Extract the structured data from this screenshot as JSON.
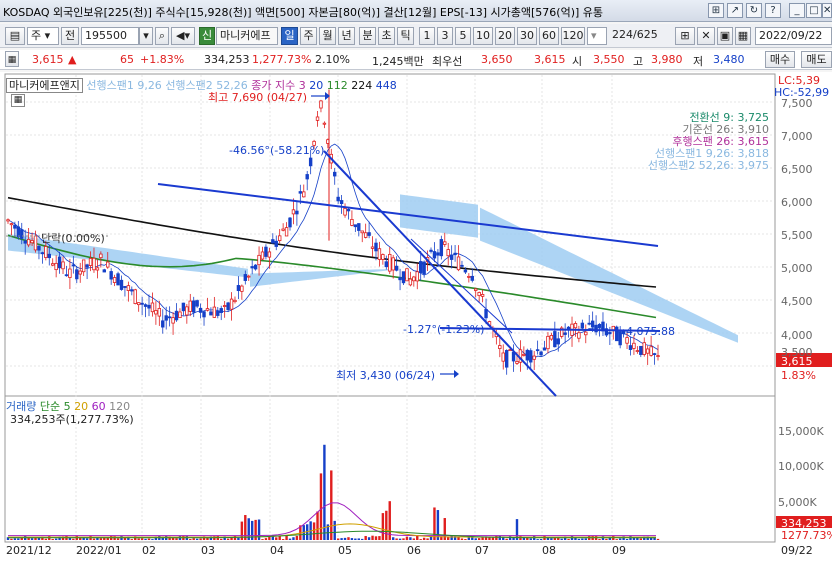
{
  "window": {
    "title": "KOSDAQ 외국인보유[225(천)] 주식수[15,928(천)] 액면[500] 자본금[80(억)] 결산[12월] EPS[-13] 시가총액[576(억)] 유통",
    "buttons": [
      "⊞",
      "↗",
      "↻",
      "?",
      "_",
      "□",
      "✕"
    ]
  },
  "toolbar": {
    "market": "주",
    "code_icon": "전",
    "code": "195500",
    "name_badge": "신",
    "name": "마니커에프",
    "period_tabs": [
      "일",
      "주",
      "월",
      "년",
      "분",
      "초",
      "틱"
    ],
    "period_active": "일",
    "intervals": [
      "1",
      "3",
      "5",
      "10",
      "20",
      "30",
      "60",
      "120"
    ],
    "page": "224",
    "total": "/625",
    "date": "2022/09/22",
    "buy": "매수",
    "sell": "매도"
  },
  "price_row": {
    "price": "3,615",
    "arrow": "▲",
    "change": "65",
    "pct": "+1.83%",
    "volume": "334,253",
    "vol_pct": "1,277.73%",
    "turnover": "2.10%",
    "amount": "1,245백만",
    "label_min": "최우선",
    "ask": "3,650",
    "bid": "3,615",
    "open_label": "시",
    "open": "3,550",
    "high_label": "고",
    "high": "3,980",
    "low_label": "저",
    "low": "3,480"
  },
  "legend": {
    "name": "마니커에프앤지",
    "span1": "선행스팬1 9,26",
    "span2": "선행스팬2 52,26",
    "ma_label": "종가 지수 3",
    "ma20": "20",
    "ma112": "112",
    "ma224": "224",
    "ma448": "448",
    "lc": "LC:5,39",
    "hc": "HC:-52,99"
  },
  "ichimoku_values": [
    {
      "label": "전환선 9: 3,725",
      "color": "#1a8a6a"
    },
    {
      "label": "기준선 26: 3,910",
      "color": "#777777"
    },
    {
      "label": "후행스팬 26: 3,615",
      "color": "#b0309a"
    },
    {
      "label": "선행스팬1 9,26: 3,818",
      "color": "#8ab8e0"
    },
    {
      "label": "선행스팬2 52,26: 3,975",
      "color": "#8ab8e0"
    }
  ],
  "annotations": {
    "high": "최고 7,690 (04/27)",
    "low": "최저 3,430 (06/24)",
    "trend1": "-46.56°(-58.21%)",
    "trend2": "-1.27°(-1.23%)",
    "trend2_end": "4,075.88",
    "left_label": "단락(0.00%)"
  },
  "price_axis": [
    "7,500",
    "7,000",
    "6,500",
    "6,000",
    "5,500",
    "5,000",
    "4,500",
    "4,000",
    "3,500"
  ],
  "current_price_tag": "3,615",
  "current_pct_tag": "1.83%",
  "volume_legend": {
    "title": "거래량",
    "ma_label": "단순 5",
    "ma20": "20",
    "ma60": "60",
    "ma120": "120",
    "value": "334,253주(1,277.73%)"
  },
  "volume_axis": [
    "15,000K",
    "10,000K",
    "5,000K"
  ],
  "volume_tag": "334,253",
  "volume_pct_tag": "1277.73%",
  "date_axis": [
    "2021/12",
    "2022/01",
    "02",
    "03",
    "04",
    "05",
    "06",
    "07",
    "08",
    "09",
    "09/22"
  ],
  "colors": {
    "up": "#e01e1e",
    "down": "#1540c8",
    "cloud": "#9fcdf2",
    "ma_black": "#111111",
    "ma_green": "#2a8a2a",
    "trend": "#1a3ad0"
  },
  "chart_data": {
    "type": "candlestick",
    "title": "마니커에프앤지",
    "series": [
      {
        "name": "종가",
        "approx_close": [
          5700,
          5300,
          4900,
          5100,
          4600,
          4200,
          4400,
          4300,
          5000,
          5600,
          6600,
          5800,
          5200,
          4800,
          5300,
          4900,
          3600,
          3700,
          4000,
          4100,
          3900,
          3600
        ]
      },
      {
        "name": "224",
        "approx": [
          6100,
          5600,
          5100,
          4700
        ]
      },
      {
        "name": "112",
        "approx": [
          5500,
          4800,
          5100,
          4200
        ]
      }
    ],
    "ylim": [
      3300,
      7800
    ]
  }
}
